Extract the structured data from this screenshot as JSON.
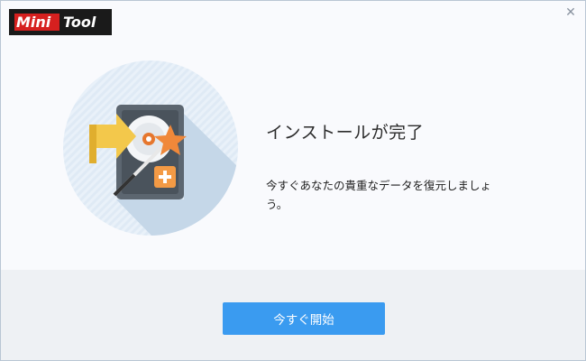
{
  "window": {
    "logo": {
      "part1": "Mini",
      "part2": "Tool"
    },
    "close_icon": "close-icon"
  },
  "hero": {
    "icon": "hard-drive-recovery-icon",
    "colors": {
      "circle": "#dbe7f3",
      "drive": "#5c6670",
      "arrow": "#f3c84b",
      "star": "#f0883a",
      "badge": "#f39a45"
    }
  },
  "content": {
    "title": "インストールが完了",
    "description": "今すぐあなたの貴重なデータを復元しましょう。"
  },
  "footer": {
    "start_button": "今すぐ開始"
  },
  "colors": {
    "accent": "#3a9bf0",
    "footer_bg": "#eef1f4",
    "body_bg": "#f9fafd"
  }
}
